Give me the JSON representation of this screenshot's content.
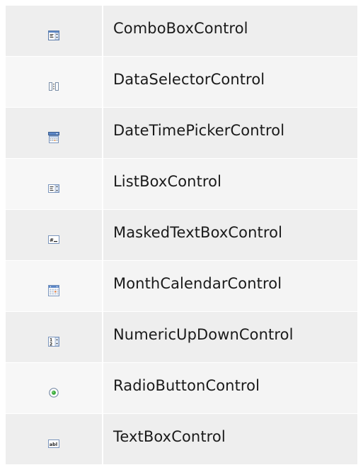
{
  "controls": [
    {
      "name": "ComboBoxControl",
      "icon": "combobox-icon"
    },
    {
      "name": "DataSelectorControl",
      "icon": "data-selector-icon"
    },
    {
      "name": "DateTimePickerControl",
      "icon": "datetime-picker-icon"
    },
    {
      "name": "ListBoxControl",
      "icon": "listbox-icon"
    },
    {
      "name": "MaskedTextBoxControl",
      "icon": "masked-textbox-icon"
    },
    {
      "name": "MonthCalendarControl",
      "icon": "month-calendar-icon"
    },
    {
      "name": "NumericUpDownControl",
      "icon": "numeric-updown-icon"
    },
    {
      "name": "RadioButtonControl",
      "icon": "radio-button-icon"
    },
    {
      "name": "TextBoxControl",
      "icon": "textbox-icon"
    }
  ]
}
